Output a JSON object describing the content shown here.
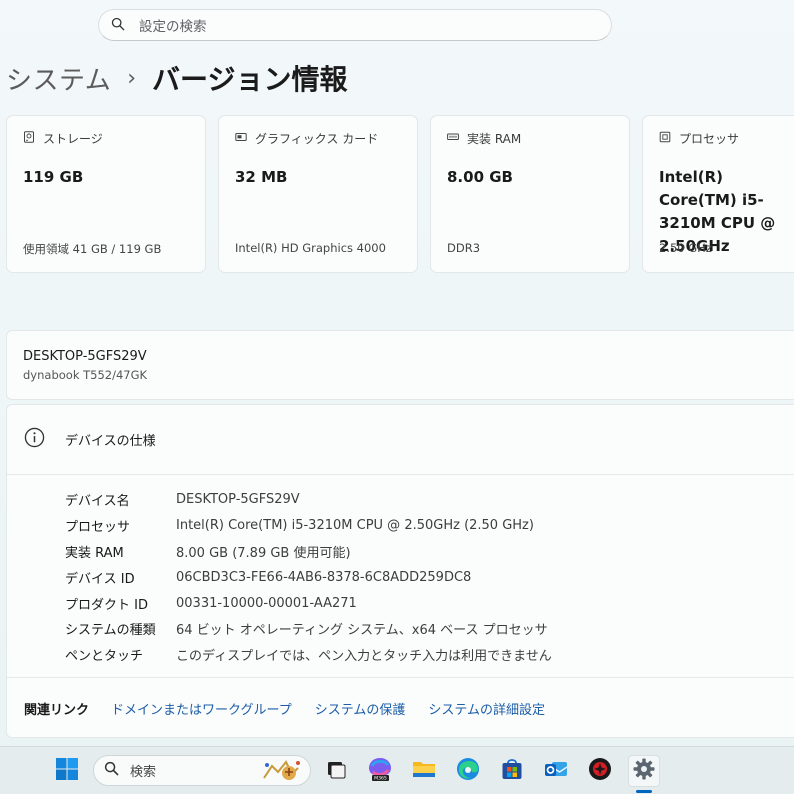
{
  "search": {
    "placeholder": "設定の検索"
  },
  "breadcrumb": {
    "parent": "システム",
    "separator": "›",
    "current": "バージョン情報"
  },
  "cards": [
    {
      "icon": "storage-icon",
      "title": "ストレージ",
      "value": "119 GB",
      "sub": "使用領域 41 GB / 119 GB"
    },
    {
      "icon": "graphics-card-icon",
      "title": "グラフィックス カード",
      "value": "32 MB",
      "sub": "Intel(R) HD Graphics 4000"
    },
    {
      "icon": "ram-icon",
      "title": "実装 RAM",
      "value": "8.00 GB",
      "sub": "DDR3"
    },
    {
      "icon": "processor-icon",
      "title": "プロセッサ",
      "value": "Intel(R) Core(TM) i5-3210M CPU @ 2.50GHz",
      "sub": "2.50 GHz"
    }
  ],
  "device": {
    "name": "DESKTOP-5GFS29V",
    "model": "dynabook T552/47GK"
  },
  "specs": {
    "title": "デバイスの仕様",
    "rows": [
      {
        "label": "デバイス名",
        "value": "DESKTOP-5GFS29V"
      },
      {
        "label": "プロセッサ",
        "value": "Intel(R) Core(TM) i5-3210M CPU @ 2.50GHz (2.50 GHz)"
      },
      {
        "label": "実装 RAM",
        "value": "8.00 GB (7.89 GB 使用可能)"
      },
      {
        "label": "デバイス ID",
        "value": "06CBD3C3-FE66-4AB6-8378-6C8ADD259DC8"
      },
      {
        "label": "プロダクト ID",
        "value": "00331-10000-00001-AA271"
      },
      {
        "label": "システムの種類",
        "value": "64 ビット オペレーティング システム、x64 ベース プロセッサ"
      },
      {
        "label": "ペンとタッチ",
        "value": "このディスプレイでは、ペン入力とタッチ入力は利用できません"
      }
    ]
  },
  "related": {
    "title": "関連リンク",
    "links": [
      "ドメインまたはワークグループ",
      "システムの保護",
      "システムの詳細設定"
    ]
  },
  "taskbar": {
    "search_label": "検索",
    "m365_badge": "M365",
    "items": [
      "windows-start-icon",
      "task-view-icon",
      "microsoft-365-icon",
      "file-explorer-icon",
      "edge-icon",
      "store-icon",
      "outlook-icon",
      "security-app-icon",
      "settings-icon"
    ],
    "colors": {
      "accent": "#0067c0",
      "link": "#1d5ea8"
    }
  }
}
